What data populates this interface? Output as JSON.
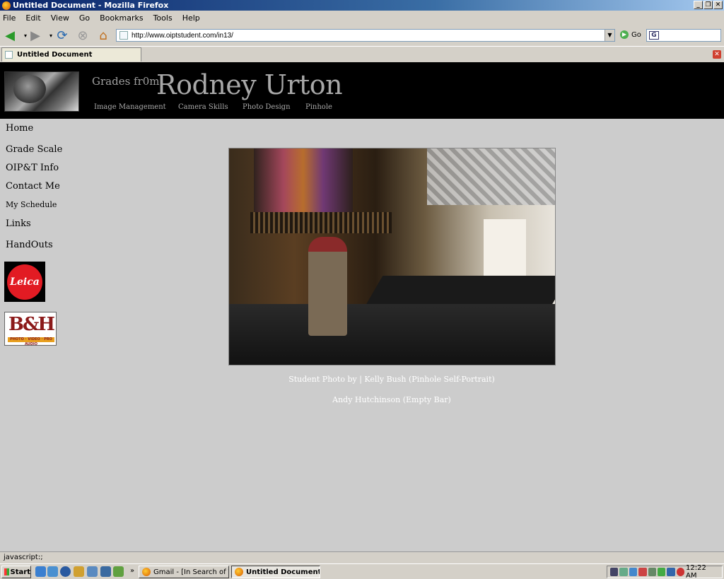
{
  "window": {
    "title": "Untitled Document - Mozilla Firefox"
  },
  "menu": [
    "File",
    "Edit",
    "View",
    "Go",
    "Bookmarks",
    "Tools",
    "Help"
  ],
  "toolbar": {
    "url": "http://www.oiptstudent.com/in13/",
    "go_label": "Go"
  },
  "tab": {
    "title": "Untitled Document"
  },
  "header": {
    "tagline": "Grades fr0m",
    "site_name": "Rodney Urton",
    "nav": [
      "Image Management",
      "Camera Skills",
      "Photo Design",
      "Pinhole"
    ]
  },
  "sidebar": {
    "links": [
      "Home",
      "Grade Scale",
      "OIP&T Info",
      "Contact Me",
      "My Schedule",
      "Links",
      "HandOuts"
    ],
    "logos": {
      "leica": "Leica",
      "bh_letters": "B&H",
      "bh_strip": "PHOTO · VIDEO · PRO AUDIO"
    }
  },
  "main": {
    "caption_line1": "Student Photo by | Kelly Bush (Pinhole Self-Portrait)",
    "caption_line2": "Andy Hutchinson (Empty Bar)"
  },
  "status": {
    "text": "javascript:;"
  },
  "taskbar": {
    "start_label": "Start",
    "overflow": "»",
    "tasks": [
      "Gmail - [In Search of Tha...",
      "Untitled Document - ..."
    ],
    "clock": "12:22 AM"
  },
  "colors": {
    "header_bg": "#000000",
    "page_bg": "#cccccc",
    "title_gradient_start": "#0a246a"
  }
}
